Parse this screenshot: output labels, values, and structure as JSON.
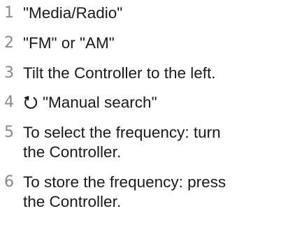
{
  "steps": [
    {
      "number": "1",
      "text": "\"Media/Radio\""
    },
    {
      "number": "2",
      "text": "\"FM\" or \"AM\""
    },
    {
      "number": "3",
      "text": "Tilt the Controller to the left."
    },
    {
      "number": "4",
      "icon": "controller-turn-icon",
      "text": "\"Manual search\""
    },
    {
      "number": "5",
      "line1": "To select the frequency: turn",
      "line2": "the Controller."
    },
    {
      "number": "6",
      "line1": "To store the frequency: press",
      "line2": "the Controller."
    }
  ]
}
